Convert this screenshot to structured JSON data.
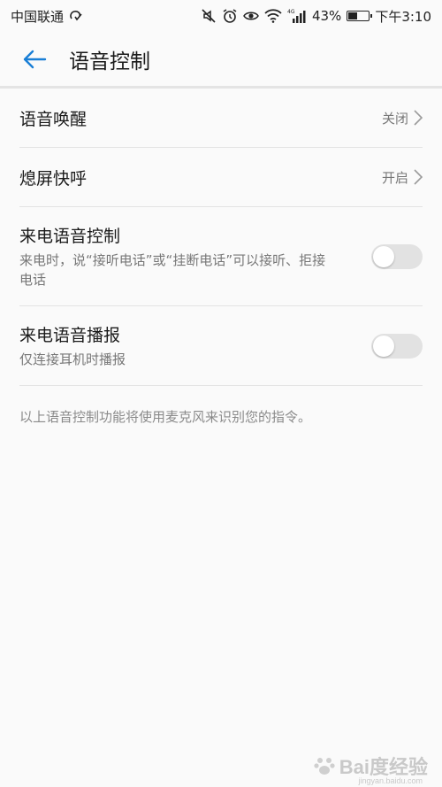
{
  "status_bar": {
    "carrier": "中国联通",
    "network": "4G",
    "battery": "43%",
    "battery_level": 0.43,
    "time": "下午3:10",
    "icons": [
      "hd-icon",
      "mute-icon",
      "alarm-icon",
      "eye-icon",
      "wifi-icon",
      "signal-icon",
      "battery-icon"
    ]
  },
  "header": {
    "title": "语音控制",
    "accent": "#1a7fd6"
  },
  "rows": [
    {
      "title": "语音唤醒",
      "value": "关闭"
    },
    {
      "title": "熄屏快呼",
      "value": "开启"
    },
    {
      "title": "来电语音控制",
      "subtitle": "来电时，说“接听电话”或“挂断电话”可以接听、拒接电话",
      "enabled": false
    },
    {
      "title": "来电语音播报",
      "subtitle": "仅连接耳机时播报",
      "enabled": false
    }
  ],
  "footer_note": "以上语音控制功能将使用麦克风来识别您的指令。",
  "watermark": {
    "brand": "Bai度经验",
    "url": "jingyan.baidu.com"
  }
}
